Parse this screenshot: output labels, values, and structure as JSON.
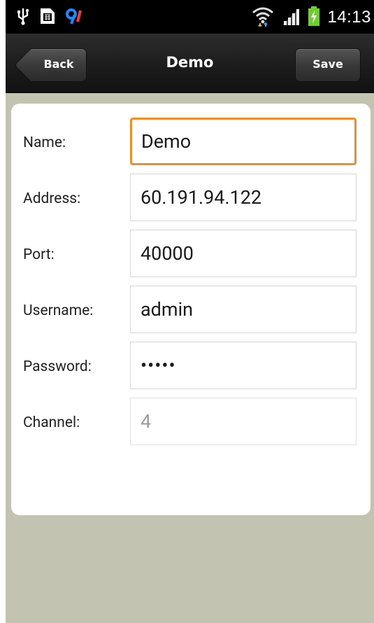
{
  "status_bar": {
    "icons": [
      "usb-icon",
      "sim-card-icon",
      "notification-icon",
      "wifi-icon",
      "signal-icon",
      "battery-charging-icon"
    ],
    "time": "14:13"
  },
  "header": {
    "title": "Demo",
    "back_label": "Back",
    "save_label": "Save"
  },
  "form": {
    "name_label": "Name:",
    "name_value": "Demo",
    "address_label": "Address:",
    "address_value": "60.191.94.122",
    "port_label": "Port:",
    "port_value": "40000",
    "username_label": "Username:",
    "username_value": "admin",
    "password_label": "Password:",
    "password_value": "•••••",
    "channel_label": "Channel:",
    "channel_value": "4"
  },
  "colors": {
    "background": "#c3c3b2",
    "focus_border": "#f28d26",
    "title_bar": "#1c1c1c"
  }
}
